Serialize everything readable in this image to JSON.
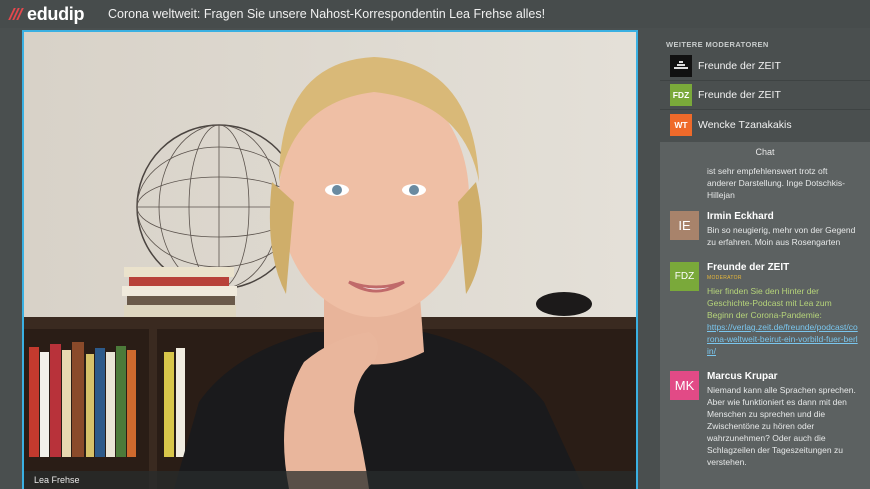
{
  "app": {
    "logo_text": "edudip",
    "event_title": "Corona weltweit: Fragen Sie unsere Nahost-Korrespondentin Lea Frehse alles!"
  },
  "video": {
    "speaker_name": "Lea Frehse"
  },
  "moderators": {
    "title": "WEITERE MODERATOREN",
    "items": [
      {
        "initials": "",
        "name": "Freunde der ZEIT",
        "color": "#111111"
      },
      {
        "initials": "FDZ",
        "name": "Freunde der ZEIT",
        "color": "#7aa93a"
      },
      {
        "initials": "WT",
        "name": "Wencke Tzanakakis",
        "color": "#ef6a2a"
      }
    ]
  },
  "chat": {
    "title": "Chat",
    "partial_text": "ist sehr empfehlenswert trotz oft anderer Darstellung. Inge Dotschkis-Hillejan",
    "messages": [
      {
        "initials": "IE",
        "color": "#a8836b",
        "author": "Irmin Eckhard",
        "text": "Bin so neugierig, mehr von der Gegend zu erfahren. Moin aus Rosengarten"
      },
      {
        "initials": "FDZ",
        "color": "#7aa93a",
        "author": "Freunde der ZEIT",
        "role": "MODERATOR",
        "text": "Hier finden Sie den Hinter der Geschichte-Podcast mit Lea zum Beginn der Corona-Pandemie:",
        "link": "https://verlag.zeit.de/freunde/podcast/corona-weltweit-beirut-ein-vorbild-fuer-berlin/"
      },
      {
        "initials": "MK",
        "color": "#e24a86",
        "author": "Marcus Krupar",
        "text": "Niemand kann alle Sprachen sprechen. Aber wie funktioniert es dann mit den Menschen zu sprechen und die Zwischentöne zu hören oder wahrzunehmen? Oder auch die Schlagzeilen der Tageszeitungen zu verstehen."
      }
    ]
  }
}
